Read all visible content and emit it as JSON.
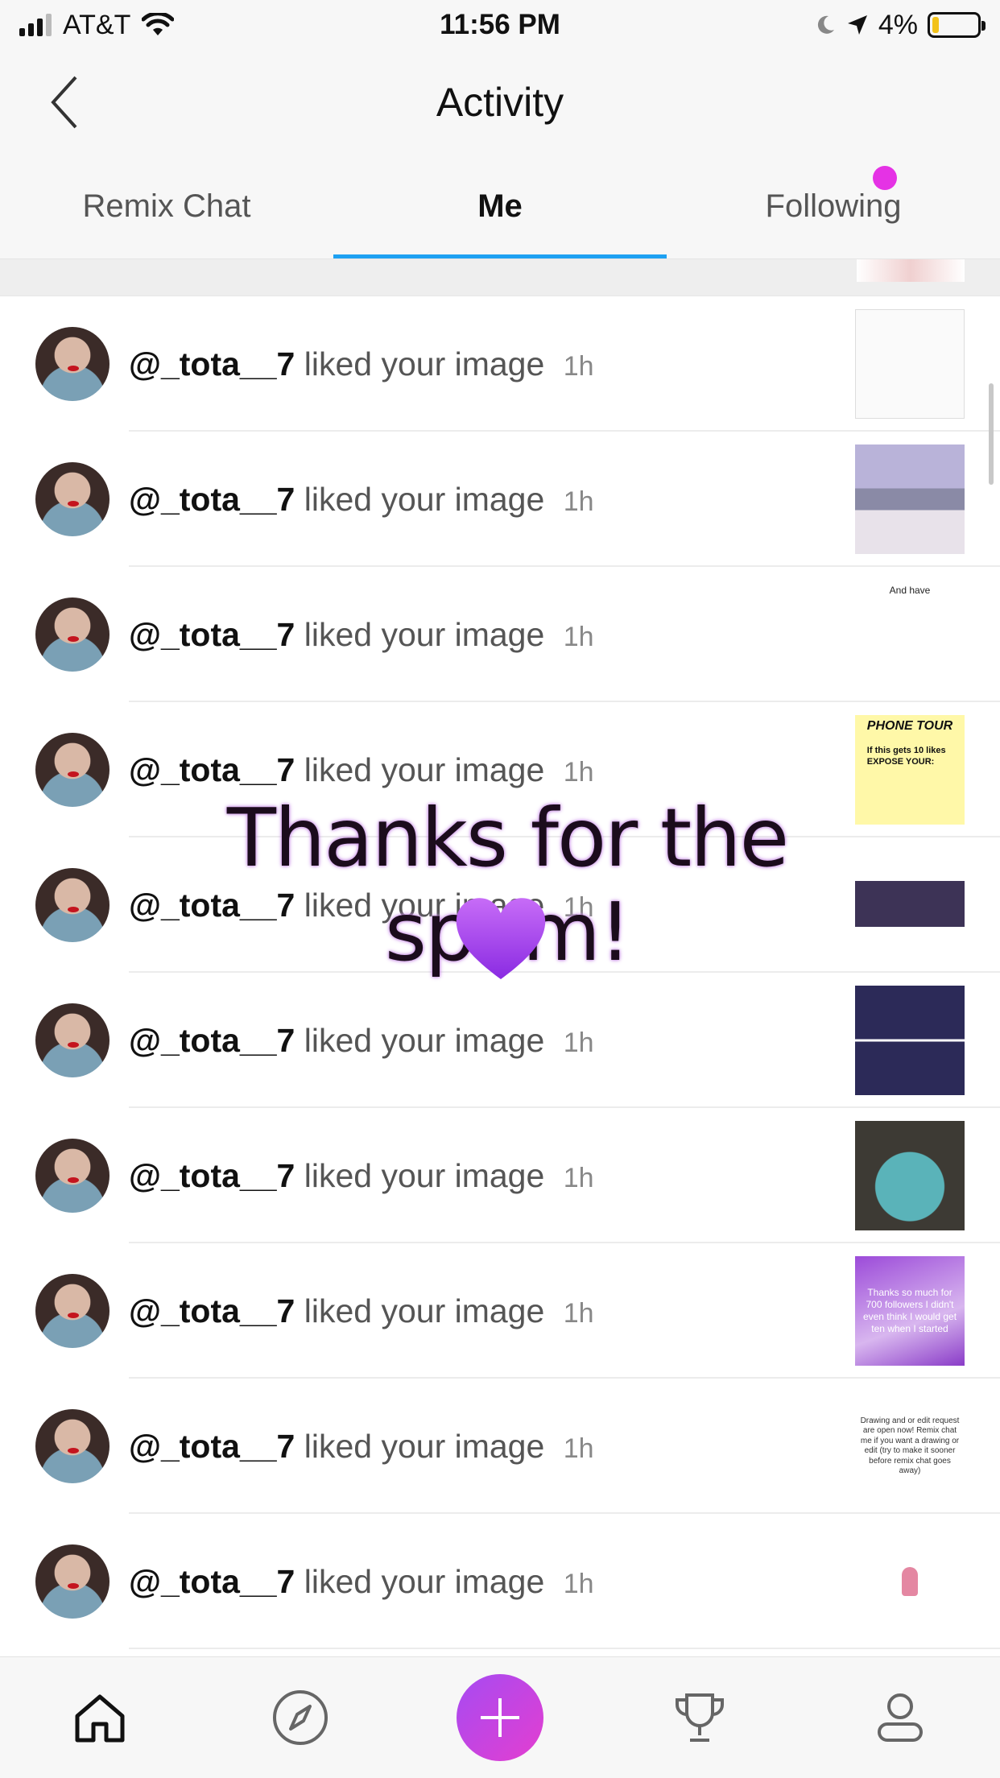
{
  "status_bar": {
    "carrier": "AT&T",
    "time": "11:56 PM",
    "battery": "4%"
  },
  "header": {
    "title": "Activity"
  },
  "tabs": [
    {
      "label": "Remix Chat",
      "active": false
    },
    {
      "label": "Me",
      "active": true
    },
    {
      "label": "Following",
      "active": false,
      "has_notification_dot": true
    }
  ],
  "activities": [
    {
      "username": "@_tota__7",
      "action": "liked your image",
      "time": "1h"
    },
    {
      "username": "@_tota__7",
      "action": "liked your image",
      "time": "1h"
    },
    {
      "username": "@_tota__7",
      "action": "liked your image",
      "time": "1h"
    },
    {
      "username": "@_tota__7",
      "action": "liked your image",
      "time": "1h"
    },
    {
      "username": "@_tota__7",
      "action": "liked your image",
      "time": "1h"
    },
    {
      "username": "@_tota__7",
      "action": "liked your image",
      "time": "1h"
    },
    {
      "username": "@_tota__7",
      "action": "liked your image",
      "time": "1h"
    },
    {
      "username": "@_tota__7",
      "action": "liked your image",
      "time": "1h"
    },
    {
      "username": "@_tota__7",
      "action": "liked your image",
      "time": "1h"
    },
    {
      "username": "@_tota__7",
      "action": "liked your image",
      "time": "1h"
    }
  ],
  "thumbnails": {
    "t3_caption": "And have",
    "t4_title": "PHONE TOUR",
    "t4_line": "If this gets 10 likes",
    "t4_sub": "EXPOSE YOUR:",
    "t8_text": "Thanks so much for 700 followers I didn't even think I would get ten when I started",
    "t9_text": "Drawing and or edit request are open now! Remix chat me if you want a drawing or edit (try to make it sooner before remix chat goes away)"
  },
  "overlay": {
    "text": "Thanks for the spam!"
  },
  "colors": {
    "accent_tab_underline": "#1ea1f2",
    "notification_dot": "#e532e5",
    "plus_button_gradient": [
      "#a64bf2",
      "#e43ed0"
    ]
  },
  "bottom_nav": [
    {
      "icon": "home-icon"
    },
    {
      "icon": "compass-icon"
    },
    {
      "icon": "plus-icon"
    },
    {
      "icon": "trophy-icon"
    },
    {
      "icon": "profile-icon"
    }
  ]
}
